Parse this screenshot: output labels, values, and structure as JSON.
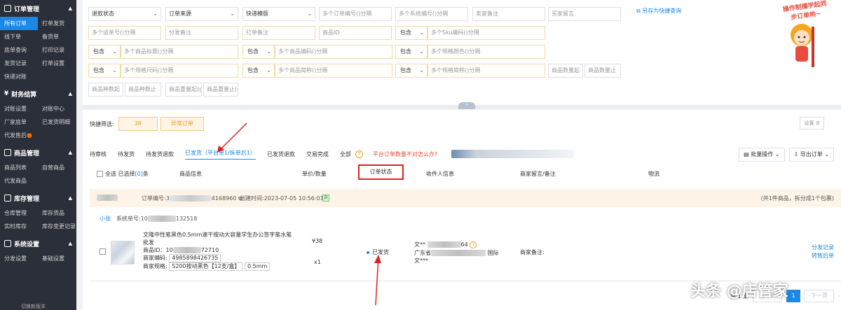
{
  "sidebar": {
    "sections": [
      {
        "title": "订单管理",
        "items": [
          "所有订单",
          "打单发货",
          "线下单",
          "备货单",
          "底单查询",
          "打印记录",
          "发货记录",
          "打单设置",
          "快递对账"
        ]
      },
      {
        "title": "财务结算",
        "items": [
          "对账设置",
          "对账中心",
          "厂家底单",
          "已发货明细",
          "代发售后"
        ]
      },
      {
        "title": "商品管理",
        "items": [
          "商品列表",
          "自营商品",
          "代发商品"
        ]
      },
      {
        "title": "库存管理",
        "items": [
          "仓库管理",
          "库存货品",
          "实时库存",
          "库存变更记录"
        ]
      },
      {
        "title": "系统设置",
        "items": [
          "分发设置",
          "基础设置"
        ]
      }
    ],
    "active_item": "所有订单",
    "bottom_text": "切换新版本"
  },
  "filters": {
    "row1": [
      "退款状态",
      "订单来源",
      "快递模版",
      "多个订单编号()分隔",
      "多个系统编号()分隔",
      "卖家备注",
      "买家留言"
    ],
    "row2": [
      "多个运单号()分隔",
      "分发备注",
      "打单备注",
      "商品ID",
      "包含",
      "多个Sku编码()分隔"
    ],
    "row3_select": "包含",
    "row3": [
      "多个商品标题()分隔",
      "多个商品编码()分隔",
      "多个规格颜色()分隔"
    ],
    "row4": [
      "多个规格尺码()分隔",
      "多个商品简称()分隔",
      "多个规格简称()分隔",
      "商品数量起",
      "商品数量止"
    ],
    "row5": [
      "商品种数起",
      "商品种数止",
      "商品重量起(g)",
      "商品重量止(g)"
    ],
    "save_quick": "另存为快捷查询"
  },
  "promo": {
    "text": "操作制播学起同步订单哟~"
  },
  "quick_filter": {
    "label": "快捷筛选:",
    "chip_count": "38",
    "chip_abnormal": "异常订单",
    "settings": "设置"
  },
  "tabs": [
    "待审核",
    "待发货",
    "待发货退款",
    "已发货（平台单1/拆单后1）",
    "已发货退款",
    "交易完成",
    "全部"
  ],
  "tab_warning": "平台订单数量不对怎么办?",
  "actions": {
    "batch": "批量操作",
    "export": "导出订单"
  },
  "table_header": {
    "select_all": "全选",
    "selected": "已选择",
    "selected_count": "[0]",
    "selected_unit": "条",
    "product": "商品信息",
    "price_qty": "单价/数量",
    "status": "订单状态",
    "receiver": "收件人信息",
    "notes": "商家留言/备注",
    "logistics": "物流"
  },
  "order": {
    "order_no_label": "订单编号:3",
    "order_no_tail": "4168960",
    "created": "创建时间:2023-07-05 10:56:01",
    "tag": "自",
    "summary": "(共1件商品，拆分成1个包裹)",
    "buyer": "小张",
    "system_no_label": "系统单号:10",
    "system_no_tail": "132518",
    "product_title": "文隆中性笔黑色0.5mm速干按动大容量学生办公签字笔水笔",
    "product_sub": "批发",
    "product_id_label": "商品ID：",
    "product_id_head": "10",
    "product_id_tail": "72710",
    "product_code_label": "商家编码:",
    "product_code": "4985898426735",
    "spec_label": "商家规格:",
    "spec_value": "S200按动黑色【12支/盒】",
    "spec_size": "0.5mm",
    "price": "¥38",
    "qty": "x1",
    "status": "已发货",
    "receiver_name": "文**",
    "receiver_phone_tail": "64",
    "receiver_addr_head": "广东省",
    "receiver_addr_tail": "国际",
    "receiver_name2": "文***",
    "merchant_note_label": "商家备注:",
    "action_split": "分发记录",
    "action_aftersale": "转售后单"
  },
  "pager": {
    "total": "共 1 条",
    "prev": "上一页",
    "page": "1",
    "next": "下一页"
  },
  "watermark": "头条 @店管家",
  "colors": {
    "sidebar_bg": "#2b2f3a",
    "accent": "#1e88e5",
    "warn": "#e84c3d",
    "highlight_box": "#e02020"
  }
}
